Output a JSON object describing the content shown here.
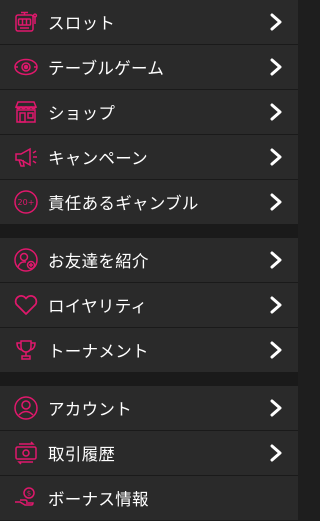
{
  "accent_color": "#e0186c",
  "groups": [
    {
      "items": [
        {
          "label": "スロット",
          "icon": "slot-machine-icon"
        },
        {
          "label": "テーブルゲーム",
          "icon": "chip-eye-icon"
        },
        {
          "label": "ショップ",
          "icon": "shop-icon"
        },
        {
          "label": "キャンペーン",
          "icon": "megaphone-icon"
        },
        {
          "label": "責任あるギャンブル",
          "icon": "age-20-icon",
          "icon_text": "20+"
        }
      ]
    },
    {
      "items": [
        {
          "label": "お友達を紹介",
          "icon": "refer-friend-icon"
        },
        {
          "label": "ロイヤリティ",
          "icon": "heart-icon"
        },
        {
          "label": "トーナメント",
          "icon": "trophy-icon"
        }
      ]
    },
    {
      "items": [
        {
          "label": "アカウント",
          "icon": "account-icon"
        },
        {
          "label": "取引履歴",
          "icon": "transaction-icon"
        },
        {
          "label": "ボーナス情報",
          "icon": "bonus-icon"
        }
      ]
    }
  ]
}
